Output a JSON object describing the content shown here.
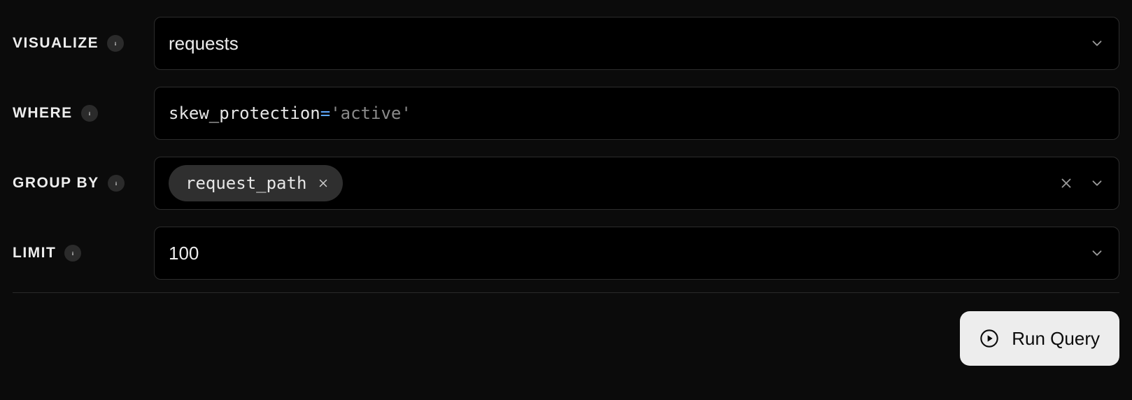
{
  "labels": {
    "visualize": "VISUALIZE",
    "where": "WHERE",
    "group_by": "GROUP BY",
    "limit": "LIMIT"
  },
  "visualize": {
    "value": "requests"
  },
  "where": {
    "field": "skew_protection",
    "operator": "=",
    "value": "'active'"
  },
  "group_by": {
    "chips": [
      {
        "label": "request_path"
      }
    ]
  },
  "limit": {
    "value": "100"
  },
  "actions": {
    "run_label": "Run Query"
  }
}
